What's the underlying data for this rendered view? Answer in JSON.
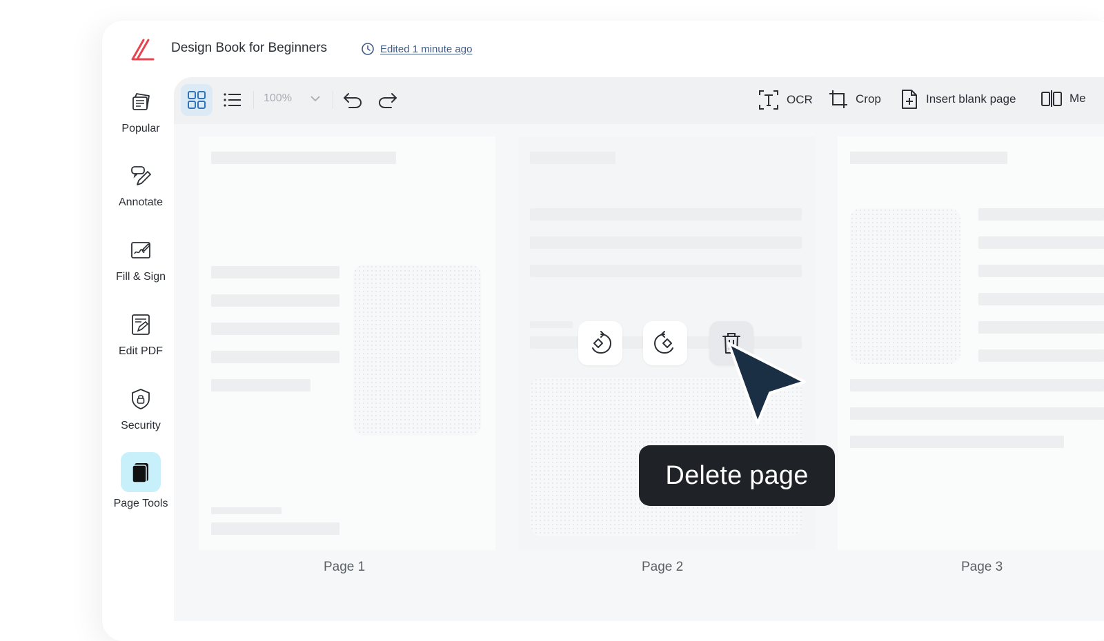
{
  "header": {
    "logo_icon": "brand-logo-icon",
    "title": "Design Book for Beginners",
    "edited_icon": "clock-icon",
    "edited_label": "Edited 1 minute ago"
  },
  "sidebar": {
    "items": [
      {
        "label": "Popular",
        "icon": "popular-icon"
      },
      {
        "label": "Annotate",
        "icon": "annotate-icon"
      },
      {
        "label": "Fill & Sign",
        "icon": "fill-sign-icon"
      },
      {
        "label": "Edit PDF",
        "icon": "edit-pdf-icon"
      },
      {
        "label": "Security",
        "icon": "shield-lock-icon"
      },
      {
        "label": "Page Tools",
        "icon": "page-tools-icon",
        "active": true
      }
    ]
  },
  "toolbar": {
    "grid_view_icon": "grid-view-icon",
    "list_view_icon": "list-view-icon",
    "zoom_value": "100%",
    "undo_icon": "undo-icon",
    "redo_icon": "redo-icon",
    "ocr_label": "OCR",
    "crop_label": "Crop",
    "insert_blank_label": "Insert blank page",
    "merge_label": "Me"
  },
  "pages": [
    {
      "label": "Page 1"
    },
    {
      "label": "Page 2"
    },
    {
      "label": "Page 3"
    }
  ],
  "page_actions": {
    "rotate_left_icon": "rotate-left-icon",
    "rotate_right_icon": "rotate-right-icon",
    "delete_icon": "trash-icon"
  },
  "tooltip": {
    "text": "Delete page"
  },
  "colors": {
    "brand": "#e8434f",
    "active_tab_bg": "#c8f0fb",
    "view_toggle_active_bg": "#dbeaf5",
    "tooltip_bg": "#1f2328",
    "cursor": "#1a2e44"
  }
}
